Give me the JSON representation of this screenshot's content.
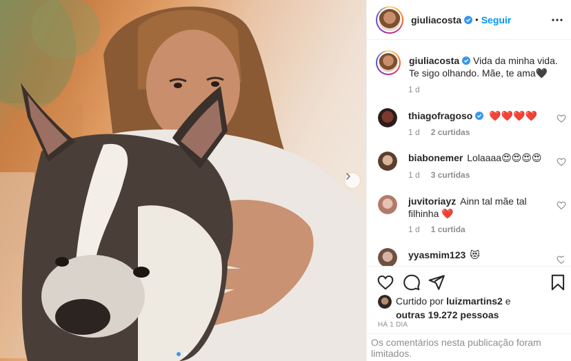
{
  "post": {
    "author": "giuliacosta",
    "follow_label": "Seguir",
    "separator": "•",
    "caption": "Vida da minha vida. Te sigo olhando. Mãe, te ama🖤",
    "caption_time": "1 d"
  },
  "comments": [
    {
      "username": "thiagofragoso",
      "verified": true,
      "text": "❤️❤️❤️❤️",
      "time": "1 d",
      "likes": "2 curtidas"
    },
    {
      "username": "biabonemer",
      "verified": false,
      "text": "Lolaaaa😍😍😍😍",
      "time": "1 d",
      "likes": "3 curtidas"
    },
    {
      "username": "juvitoriayz",
      "verified": false,
      "text": "Ainn tal mãe tal filhinha ❤️",
      "time": "1 d",
      "likes": "1 curtida"
    },
    {
      "username": "yyasmim123",
      "verified": false,
      "text": "😻",
      "time": "",
      "likes": ""
    }
  ],
  "likes": {
    "prefix": "Curtido por",
    "user": "luizmartins2",
    "joiner": "e",
    "others": "outras 19.272 pessoas"
  },
  "posted_ago": "HÁ 1 DIA",
  "comments_limited": "Os comentários nesta publicação foram limitados.",
  "carousel": {
    "slide": 1,
    "total": 2
  },
  "icons": {
    "more": "more-options-icon",
    "verified": "verified-badge-icon",
    "like": "heart-outline-icon",
    "comment": "comment-bubble-icon",
    "share": "paper-plane-icon",
    "save": "bookmark-icon",
    "next": "chevron-right-icon"
  },
  "colors": {
    "accent": "#0095f6",
    "heart": "#ed4956",
    "muted": "#8e8e8e",
    "border": "#efefef"
  }
}
